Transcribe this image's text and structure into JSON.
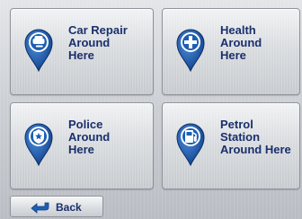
{
  "tiles": [
    {
      "label": "Car Repair\nAround\nHere",
      "icon": "car-repair-icon"
    },
    {
      "label": "Health\nAround\nHere",
      "icon": "health-cross-icon"
    },
    {
      "label": "Police\nAround\nHere",
      "icon": "police-badge-icon"
    },
    {
      "label": "Petrol\nStation\nAround Here",
      "icon": "fuel-pump-icon"
    }
  ],
  "back": {
    "label": "Back",
    "icon": "back-arrow-icon"
  },
  "colors": {
    "pin_blue": "#1d5fb3",
    "pin_dark": "#0f3f86",
    "label_text": "#1a2f6c"
  }
}
